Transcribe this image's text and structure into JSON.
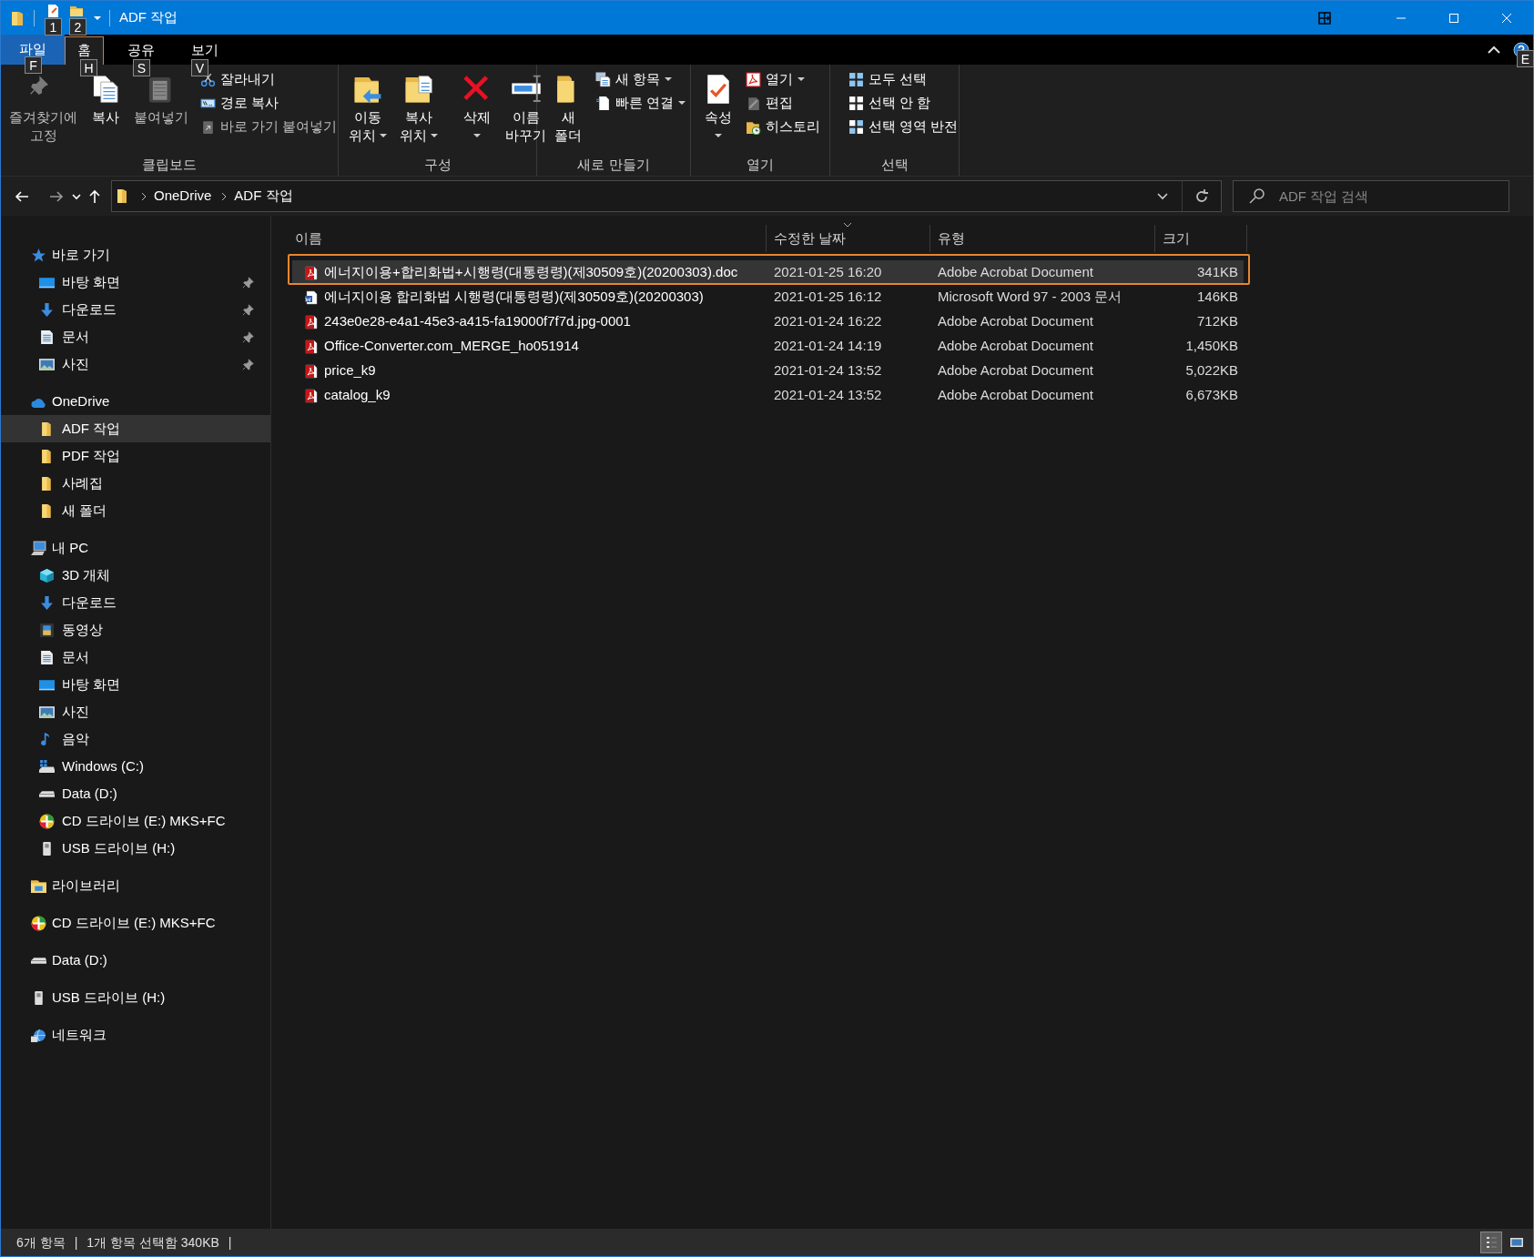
{
  "title_bar": {
    "title": "ADF 작업",
    "keytips": [
      "1",
      "2"
    ]
  },
  "ribbon_tabs": [
    {
      "label": "파일",
      "keytip": "F",
      "kind": "file",
      "selected": false
    },
    {
      "label": "홈",
      "keytip": "H",
      "kind": "tab",
      "selected": true
    },
    {
      "label": "공유",
      "keytip": "S",
      "kind": "tab",
      "selected": false
    },
    {
      "label": "보기",
      "keytip": "V",
      "kind": "tab",
      "selected": false
    }
  ],
  "help_keytip": "E",
  "ribbon_groups": [
    {
      "label": "클립보드",
      "items": [
        {
          "kind": "large",
          "lines": [
            "즐겨찾기에",
            "고정"
          ],
          "dropdown": false,
          "disabled": true
        },
        {
          "kind": "large",
          "lines": [
            "복사"
          ],
          "dropdown": false,
          "disabled": false
        },
        {
          "kind": "large",
          "lines": [
            "붙여넣기"
          ],
          "dropdown": false,
          "disabled": true
        },
        {
          "kind": "small",
          "label": "잘라내기",
          "dropdown": false,
          "disabled": false
        },
        {
          "kind": "small",
          "label": "경로 복사",
          "dropdown": false,
          "disabled": false
        },
        {
          "kind": "small",
          "label": "바로 가기 붙여넣기",
          "dropdown": false,
          "disabled": true
        }
      ]
    },
    {
      "label": "구성",
      "items": [
        {
          "kind": "large",
          "lines": [
            "이동",
            "위치"
          ],
          "dropdown": true,
          "disabled": false
        },
        {
          "kind": "large",
          "lines": [
            "복사",
            "위치"
          ],
          "dropdown": true,
          "disabled": false
        },
        {
          "kind": "divider"
        },
        {
          "kind": "large",
          "lines": [
            "삭제"
          ],
          "dropdown": true,
          "disabled": false
        },
        {
          "kind": "large",
          "lines": [
            "이름",
            "바꾸기"
          ],
          "dropdown": false,
          "disabled": false
        }
      ]
    },
    {
      "label": "새로 만들기",
      "items": [
        {
          "kind": "large",
          "lines": [
            "새",
            "폴더"
          ],
          "dropdown": false,
          "disabled": false
        },
        {
          "kind": "small",
          "label": "새 항목",
          "dropdown": true,
          "disabled": false
        },
        {
          "kind": "small",
          "label": "빠른 연결",
          "dropdown": true,
          "disabled": false
        }
      ]
    },
    {
      "label": "열기",
      "items": [
        {
          "kind": "large",
          "lines": [
            "속성"
          ],
          "dropdown": true,
          "disabled": false
        },
        {
          "kind": "small",
          "label": "열기",
          "dropdown": true,
          "disabled": false
        },
        {
          "kind": "small",
          "label": "편집",
          "dropdown": false,
          "disabled": false
        },
        {
          "kind": "small",
          "label": "히스토리",
          "dropdown": false,
          "disabled": false
        }
      ]
    },
    {
      "label": "선택",
      "items": [
        {
          "kind": "small",
          "label": "모두 선택",
          "dropdown": false,
          "disabled": false
        },
        {
          "kind": "small",
          "label": "선택 안 함",
          "dropdown": false,
          "disabled": false
        },
        {
          "kind": "small",
          "label": "선택 영역 반전",
          "dropdown": false,
          "disabled": false
        }
      ]
    }
  ],
  "address_bar": {
    "path": [
      "OneDrive",
      "ADF 작업"
    ],
    "search_placeholder": "ADF 작업 검색"
  },
  "navigation_pane": [
    {
      "label": "바로 가기",
      "kind": "star",
      "selected": false,
      "children": [
        {
          "label": "바탕 화면",
          "kind": "desktop",
          "pinned": true,
          "selected": false
        },
        {
          "label": "다운로드",
          "kind": "download",
          "pinned": true,
          "selected": false
        },
        {
          "label": "문서",
          "kind": "document",
          "pinned": true,
          "selected": false
        },
        {
          "label": "사진",
          "kind": "pictures",
          "pinned": true,
          "selected": false
        }
      ]
    },
    {
      "label": "OneDrive",
      "kind": "cloud",
      "selected": false,
      "children": [
        {
          "label": "ADF 작업",
          "kind": "folder",
          "pinned": false,
          "selected": true
        },
        {
          "label": "PDF 작업",
          "kind": "folder",
          "pinned": false,
          "selected": false
        },
        {
          "label": "사례집",
          "kind": "folder",
          "pinned": false,
          "selected": false
        },
        {
          "label": "새 폴더",
          "kind": "folder",
          "pinned": false,
          "selected": false
        }
      ]
    },
    {
      "label": "내 PC",
      "kind": "pc",
      "selected": false,
      "children": [
        {
          "label": "3D 개체",
          "kind": "objects",
          "pinned": false,
          "selected": false
        },
        {
          "label": "다운로드",
          "kind": "download",
          "pinned": false,
          "selected": false
        },
        {
          "label": "동영상",
          "kind": "video",
          "pinned": false,
          "selected": false
        },
        {
          "label": "문서",
          "kind": "document",
          "pinned": false,
          "selected": false
        },
        {
          "label": "바탕 화면",
          "kind": "desktop",
          "pinned": false,
          "selected": false
        },
        {
          "label": "사진",
          "kind": "pictures",
          "pinned": false,
          "selected": false
        },
        {
          "label": "음악",
          "kind": "music",
          "pinned": false,
          "selected": false
        },
        {
          "label": "Windows (C:)",
          "kind": "system",
          "pinned": false,
          "selected": false
        },
        {
          "label": "Data (D:)",
          "kind": "drive",
          "pinned": false,
          "selected": false
        },
        {
          "label": "CD 드라이브 (E:) MKS+FC",
          "kind": "cd",
          "pinned": false,
          "selected": false
        },
        {
          "label": "USB 드라이브 (H:)",
          "kind": "usb",
          "pinned": false,
          "selected": false
        }
      ]
    },
    {
      "label": "라이브러리",
      "kind": "library",
      "selected": false
    },
    {
      "label": "CD 드라이브 (E:) MKS+FC",
      "kind": "cd",
      "selected": false
    },
    {
      "label": "Data (D:)",
      "kind": "drive",
      "selected": false
    },
    {
      "label": "USB 드라이브 (H:)",
      "kind": "usb",
      "selected": false
    },
    {
      "label": "네트워크",
      "kind": "network",
      "selected": false
    }
  ],
  "file_list": {
    "columns": [
      {
        "label": "이름",
        "sorted": false
      },
      {
        "label": "수정한 날짜",
        "sorted": true
      },
      {
        "label": "유형",
        "sorted": false
      },
      {
        "label": "크기",
        "sorted": false
      }
    ],
    "rows": [
      {
        "name": "에너지이용+합리화법+시행령(대통령령)(제30509호)(20200303).doc",
        "date": "2021-01-25 16:20",
        "type": "Adobe Acrobat Document",
        "size": "341KB",
        "kind": "pdf",
        "selected": true
      },
      {
        "name": "에너지이용 합리화법 시행령(대통령령)(제30509호)(20200303)",
        "date": "2021-01-25 16:12",
        "type": "Microsoft Word 97 - 2003 문서",
        "size": "146KB",
        "kind": "word",
        "selected": false
      },
      {
        "name": "243e0e28-e4a1-45e3-a415-fa19000f7f7d.jpg-0001",
        "date": "2021-01-24 16:22",
        "type": "Adobe Acrobat Document",
        "size": "712KB",
        "kind": "pdf",
        "selected": false
      },
      {
        "name": "Office-Converter.com_MERGE_ho051914",
        "date": "2021-01-24 14:19",
        "type": "Adobe Acrobat Document",
        "size": "1,450KB",
        "kind": "pdf",
        "selected": false
      },
      {
        "name": "price_k9",
        "date": "2021-01-24 13:52",
        "type": "Adobe Acrobat Document",
        "size": "5,022KB",
        "kind": "pdf",
        "selected": false
      },
      {
        "name": "catalog_k9",
        "date": "2021-01-24 13:52",
        "type": "Adobe Acrobat Document",
        "size": "6,673KB",
        "kind": "pdf",
        "selected": false
      }
    ]
  },
  "status_bar": {
    "segments": [
      {
        "text": "6개 항목",
        "separator": "|"
      },
      {
        "text": "1개 항목 선택함 340KB",
        "separator": "|"
      }
    ],
    "view_buttons": [
      {
        "selected": true
      },
      {
        "selected": false
      }
    ]
  }
}
